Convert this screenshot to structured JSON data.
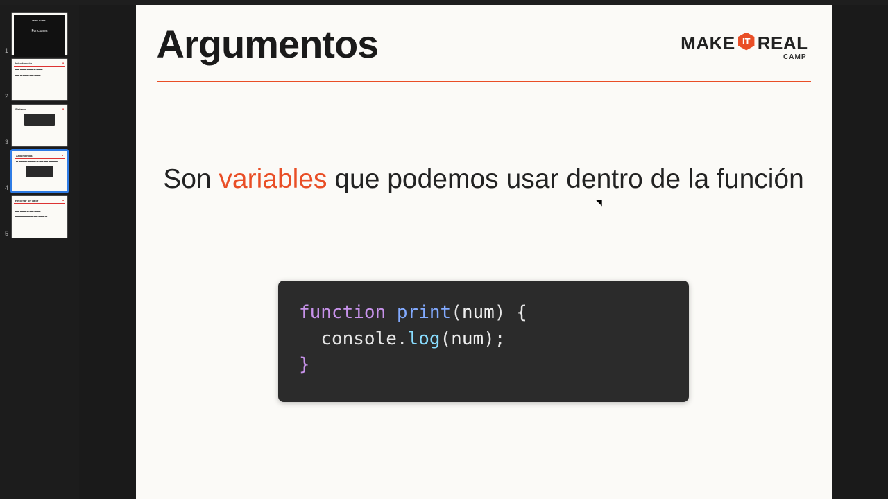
{
  "menubar": [
    "",
    "",
    "",
    "",
    "",
    "",
    "",
    "",
    "",
    "",
    "",
    ""
  ],
  "brand": {
    "make": "MAKE",
    "hex": "IT",
    "real": "REAL",
    "camp": "CAMP"
  },
  "slide": {
    "title": "Argumentos",
    "lead_pre": "Son ",
    "lead_kw": "variables",
    "lead_post": " que podemos usar dentro de la función",
    "code": {
      "l1_kw": "function",
      "l1_fn": "print",
      "l1_open": "(",
      "l1_param": "num",
      "l1_close_paren": ")",
      "l1_brace": " {",
      "l2_indent": "  ",
      "l2_obj": "console",
      "l2_dot": ".",
      "l2_method": "log",
      "l2_open": "(",
      "l2_arg": "num",
      "l2_close": ");",
      "l3_brace": "}"
    }
  },
  "thumbnails": [
    {
      "num": "1",
      "type": "cover",
      "title": "Funciones"
    },
    {
      "num": "2",
      "type": "text",
      "title": "Introducción"
    },
    {
      "num": "3",
      "type": "code",
      "title": "Sintaxis"
    },
    {
      "num": "4",
      "type": "code",
      "title": "Argumentos",
      "selected": true
    },
    {
      "num": "5",
      "type": "text",
      "title": "Retornar un valor"
    }
  ]
}
